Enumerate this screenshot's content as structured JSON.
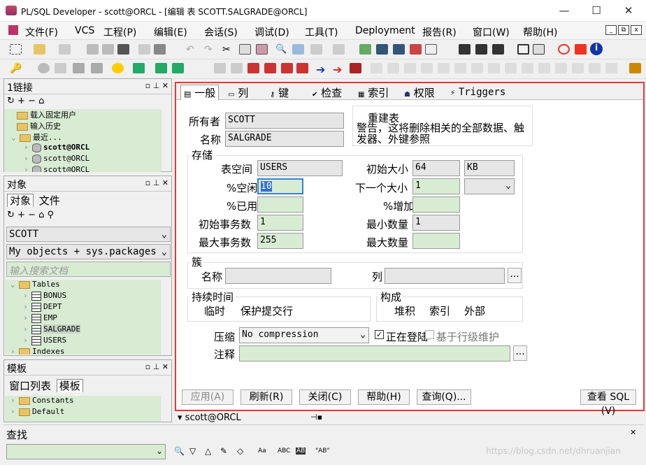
{
  "window": {
    "title": "PL/SQL Developer - scott@ORCL - [编辑 表 SCOTT.SALGRADE@ORCL]",
    "min": "—",
    "max": "☐",
    "close": "✕"
  },
  "menu": [
    "文件(F)",
    "VCS",
    "工程(P)",
    "编辑(E)",
    "会话(S)",
    "调试(D)",
    "工具(T)",
    "Deployment",
    "报告(R)",
    "窗口(W)",
    "帮助(H)"
  ],
  "mdi_buttons": [
    "_",
    "⧉",
    "x"
  ],
  "connections": {
    "title": "1链接",
    "items": [
      {
        "label": "载入固定用户",
        "type": "folder"
      },
      {
        "label": "输入历史",
        "type": "folder"
      },
      {
        "label": "最近...",
        "type": "folder"
      },
      {
        "label": "scott@ORCL",
        "type": "db"
      },
      {
        "label": "scott@ORCL",
        "type": "db"
      },
      {
        "label": "scott@ORCL",
        "type": "db"
      }
    ]
  },
  "objects": {
    "title": "对象",
    "tabs": [
      "对象",
      "文件"
    ],
    "user_select": "SCOTT",
    "filter_select": "My objects + sys.packages",
    "search_placeholder": "输入搜索文档",
    "tree": [
      {
        "label": "Tables",
        "type": "folder"
      },
      {
        "label": "BONUS",
        "type": "table"
      },
      {
        "label": "DEPT",
        "type": "table"
      },
      {
        "label": "EMP",
        "type": "table"
      },
      {
        "label": "SALGRADE",
        "type": "table"
      },
      {
        "label": "USERS",
        "type": "table"
      },
      {
        "label": "Indexes",
        "type": "folder"
      }
    ]
  },
  "templates": {
    "title": "模板",
    "tabs": [
      "窗口列表",
      "模板"
    ],
    "items": [
      "Constants",
      "Default"
    ]
  },
  "find": {
    "title": "查找",
    "buttons": [
      "ABC",
      "AB",
      "\"AB\""
    ]
  },
  "editor": {
    "tabs": [
      "一般",
      "列",
      "键",
      "检查",
      "索引",
      "权限",
      "Triggers"
    ],
    "owner_label": "所有者",
    "owner": "SCOTT",
    "name_label": "名称",
    "name": "SALGRADE",
    "rebuild_title": "重建表",
    "rebuild_warning": "警告，这将删除相关的全部数据、触发器、外键参照",
    "storage": {
      "title": "存储",
      "tablespace_label": "表空间",
      "tablespace": "USERS",
      "pctfree_label": "%空闲",
      "pctfree": "10",
      "pctused_label": "%已用",
      "pctused": "",
      "initrans_label": "初始事务数",
      "initrans": "1",
      "maxtrans_label": "最大事务数",
      "maxtrans": "255",
      "initial_label": "初始大小",
      "initial": "64",
      "initial_unit": "KB",
      "next_label": "下一个大小",
      "next": "1",
      "next_unit": "",
      "pctincrease_label": "%增加",
      "pctincrease": "",
      "minextents_label": "最小数量",
      "minextents": "1",
      "maxextents_label": "最大数量",
      "maxextents": ""
    },
    "cluster": {
      "title": "簇",
      "name_label": "名称",
      "name": "",
      "columns_label": "列",
      "columns": "",
      "browse": "..."
    },
    "duration": {
      "title": "持续时间",
      "temp": "临时",
      "preserve": "保护提交行"
    },
    "organization": {
      "title": "构成",
      "heap": "堆积",
      "index": "索引",
      "external": "外部"
    },
    "compression_label": "压缩",
    "compression": "No compression",
    "logging": "正在登陆",
    "row_movement": "基于行级维护",
    "comment_label": "注释",
    "comment": "",
    "comment_browse": "...",
    "buttons": {
      "apply": "应用(A)",
      "refresh": "刷新(R)",
      "close": "关闭(C)",
      "help": "帮助(H)",
      "query": "查询(Q)...",
      "view_sql": "查看 SQL (V)"
    }
  },
  "status": {
    "connection": "scott@ORCL",
    "watermark": "https://blog.csdn.net/dhruanjian"
  },
  "colors": {
    "accent": "#e53935",
    "panel_green": "#d8ecd4"
  }
}
